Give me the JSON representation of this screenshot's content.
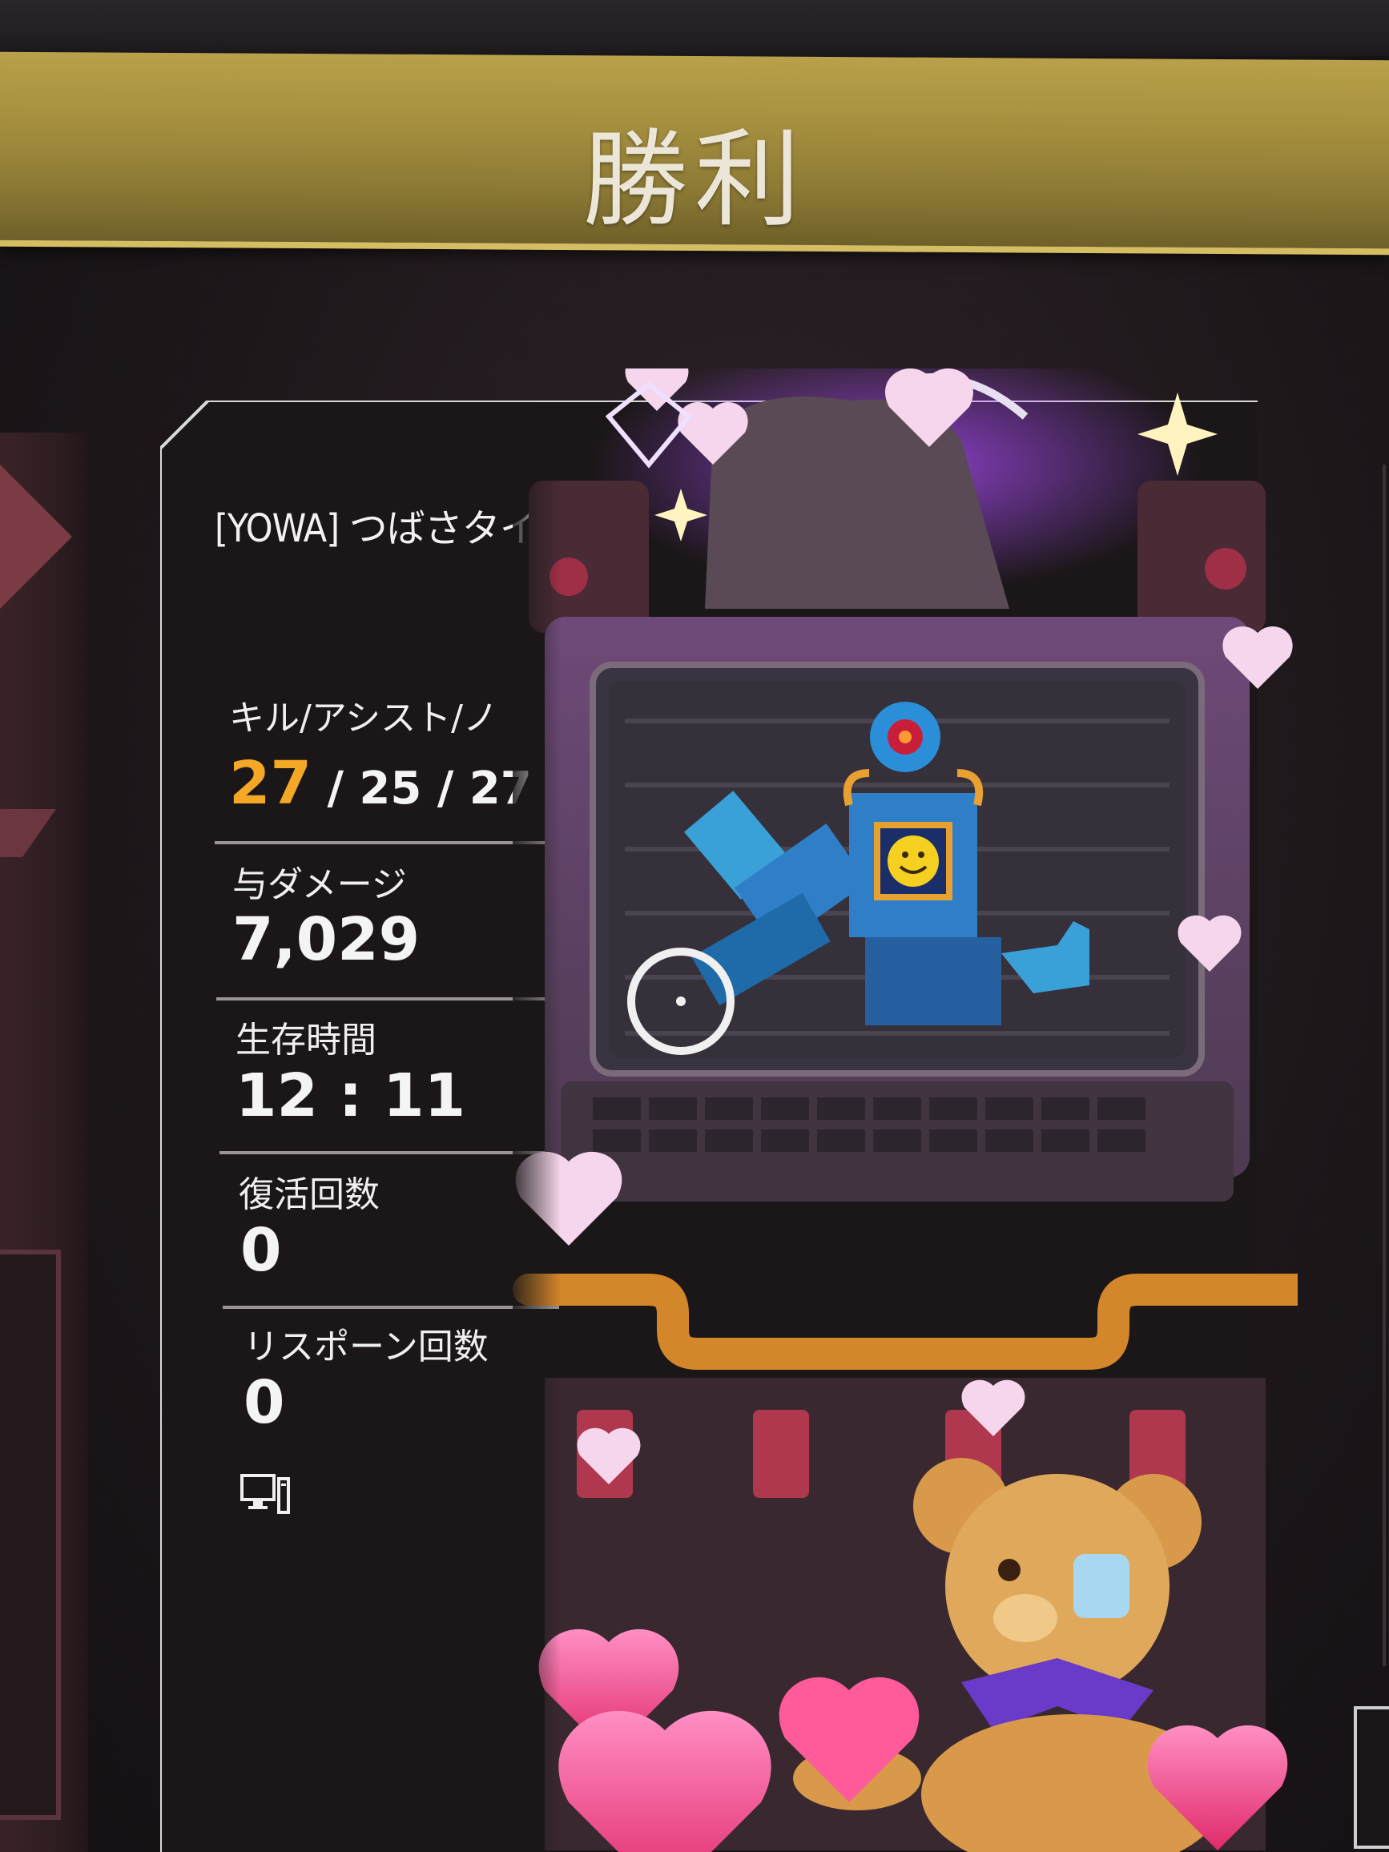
{
  "banner": {
    "title": "勝利"
  },
  "player": {
    "name": "[YOWA] つばさタイプ"
  },
  "stats": {
    "kills": {
      "label": "キル/アシスト/ノ",
      "kills": "27",
      "rest": " / 25 / 27"
    },
    "damage": {
      "label": "与ダメージ",
      "value": "7,029"
    },
    "survival": {
      "label": "生存時間",
      "value": "12 : 11"
    },
    "revives": {
      "label": "復活回数",
      "value": "0"
    },
    "respawns": {
      "label": "リスポーン回数",
      "value": "0"
    }
  },
  "platform_icon": "pc-icon",
  "colors": {
    "banner_gold": "#a6903f",
    "kills_highlight": "#f4a825",
    "card_bg": "#1b1718"
  },
  "banner_art": {
    "subject": "robot-with-monitor-face-icon",
    "decorations": [
      "heart-icon",
      "teddy-bear-icon",
      "diamond-icon",
      "sparkle-icon"
    ]
  }
}
